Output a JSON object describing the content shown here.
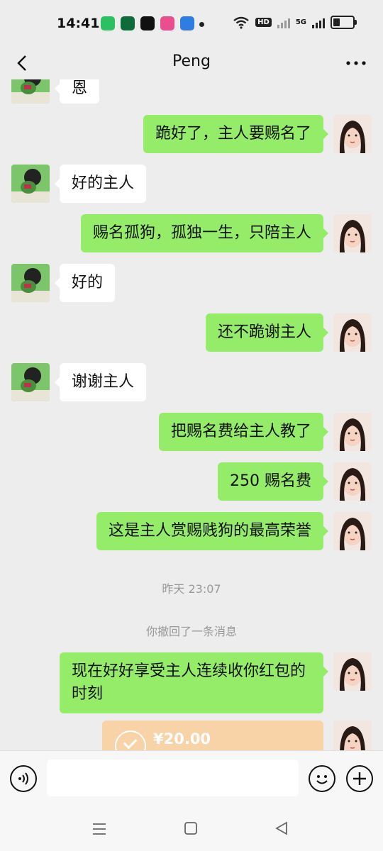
{
  "status_bar": {
    "time": "14:41",
    "signal_label_1": "HD",
    "signal_label_2": "5G",
    "app_icons": [
      "wechat-icon",
      "oppo-icon",
      "tiktok-icon",
      "game-icon",
      "shop-icon"
    ]
  },
  "header": {
    "title": "Peng",
    "back_icon": "chevron-left-icon",
    "more_icon": "more-dots-icon"
  },
  "messages": [
    {
      "side": "in",
      "text": "恩",
      "partial": true
    },
    {
      "side": "out",
      "text": "跪好了，主人要赐名了"
    },
    {
      "side": "in",
      "text": "好的主人"
    },
    {
      "side": "out",
      "text": "赐名孤狗，孤独一生，只陪主人"
    },
    {
      "side": "in",
      "text": "好的"
    },
    {
      "side": "out",
      "text": "还不跪谢主人"
    },
    {
      "side": "in",
      "text": "谢谢主人"
    },
    {
      "side": "out",
      "text": "把赐名费给主人教了"
    },
    {
      "side": "out",
      "text": "250 赐名费"
    },
    {
      "side": "out",
      "text": "这是主人赏赐贱狗的最高荣誉"
    },
    {
      "side": "out",
      "text": "现在好好享受主人连续收你红包的时刻"
    }
  ],
  "system": {
    "timestamp": "昨天 23:07",
    "recall_notice": "你撤回了一条消息"
  },
  "red_packet": {
    "amount": "¥20.00"
  },
  "input_bar": {
    "placeholder": "",
    "voice_icon": "voice-icon",
    "emoji_icon": "emoji-icon",
    "plus_icon": "plus-icon"
  },
  "colors": {
    "outgoing_bubble": "#95ec69",
    "incoming_bubble": "#ffffff",
    "background": "#ededed",
    "red_packet": "#f9d3a8"
  }
}
